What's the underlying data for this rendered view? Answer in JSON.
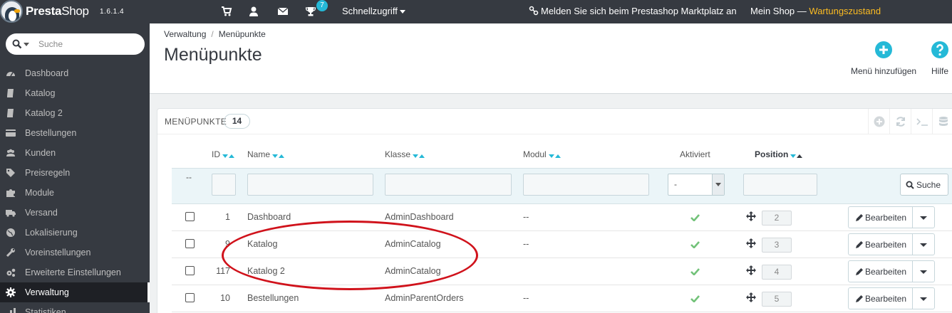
{
  "topbar": {
    "brand_main": "Presta",
    "brand_shop": "Shop",
    "version": "1.6.1.4",
    "notification_count": "7",
    "quick_access": "Schnellzugriff",
    "marketplace": "Melden Sie sich beim Prestashop Marktplatz an",
    "shop_name": "Mein Shop",
    "dash": "—",
    "maintenance": "Wartungszustand"
  },
  "sidebar": {
    "search_placeholder": "Suche",
    "items": [
      {
        "label": "Dashboard",
        "icon": "dashboard-icon"
      },
      {
        "label": "Katalog",
        "icon": "book-icon"
      },
      {
        "label": "Katalog 2",
        "icon": "book-icon"
      },
      {
        "label": "Bestellungen",
        "icon": "credit-card-icon"
      },
      {
        "label": "Kunden",
        "icon": "users-icon"
      },
      {
        "label": "Preisregeln",
        "icon": "tags-icon"
      },
      {
        "label": "Module",
        "icon": "puzzle-icon"
      },
      {
        "label": "Versand",
        "icon": "truck-icon"
      },
      {
        "label": "Lokalisierung",
        "icon": "globe-icon"
      },
      {
        "label": "Voreinstellungen",
        "icon": "wrench-icon"
      },
      {
        "label": "Erweiterte Einstellungen",
        "icon": "cogs-icon"
      },
      {
        "label": "Verwaltung",
        "icon": "gear-icon",
        "active": true
      },
      {
        "label": "Statistiken",
        "icon": "chart-icon"
      }
    ]
  },
  "header": {
    "breadcrumb_parent": "Verwaltung",
    "breadcrumb_separator": "/",
    "breadcrumb_current": "Menüpunkte",
    "title": "Menüpunkte",
    "add_button": "Menü hinzufügen",
    "help_button": "Hilfe"
  },
  "panel": {
    "title": "MENÜPUNKTE",
    "count": "14",
    "columns": {
      "id": "ID",
      "name": "Name",
      "class": "Klasse",
      "module": "Modul",
      "active": "Aktiviert",
      "position": "Position"
    },
    "filter": {
      "bulk_dashes": "--",
      "active_select_value": "-",
      "search_button": "Suche"
    },
    "edit_label": "Bearbeiten",
    "rows": [
      {
        "id": "1",
        "name": "Dashboard",
        "class": "AdminDashboard",
        "module": "--",
        "position": "2"
      },
      {
        "id": "9",
        "name": "Katalog",
        "class": "AdminCatalog",
        "module": "--",
        "position": "3"
      },
      {
        "id": "117",
        "name": "Katalog 2",
        "class": "AdminCatalog",
        "module": "",
        "position": "4"
      },
      {
        "id": "10",
        "name": "Bestellungen",
        "class": "AdminParentOrders",
        "module": "--",
        "position": "5"
      }
    ]
  },
  "colors": {
    "accent": "#25b9d7",
    "success": "#72c279",
    "annotation": "#d0121b",
    "sidebar_bg": "#363a41"
  }
}
